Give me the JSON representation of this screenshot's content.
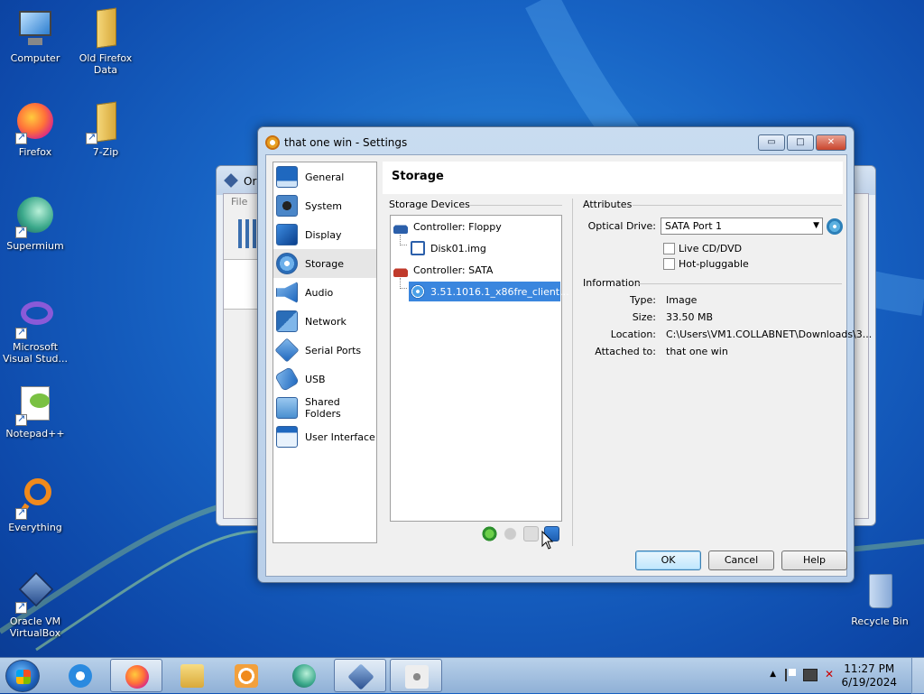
{
  "desktop": {
    "icons": [
      {
        "label": "Computer"
      },
      {
        "label": "Old Firefox Data"
      },
      {
        "label": "Firefox"
      },
      {
        "label": "7-Zip"
      },
      {
        "label": "Supermium"
      },
      {
        "label": "Microsoft Visual Stud..."
      },
      {
        "label": "Notepad++"
      },
      {
        "label": "Everything"
      },
      {
        "label": "Oracle VM VirtualBox"
      },
      {
        "label": "Recycle Bin"
      }
    ]
  },
  "background_window": {
    "title": "Ora",
    "menu_file": "File"
  },
  "dialog": {
    "title": "that one win - Settings",
    "min_glyph": "▭",
    "max_glyph": "□",
    "close_glyph": "✕",
    "nav": [
      {
        "label": "General"
      },
      {
        "label": "System"
      },
      {
        "label": "Display"
      },
      {
        "label": "Storage"
      },
      {
        "label": "Audio"
      },
      {
        "label": "Network"
      },
      {
        "label": "Serial Ports"
      },
      {
        "label": "USB"
      },
      {
        "label": "Shared Folders"
      },
      {
        "label": "User Interface"
      }
    ],
    "section_title": "Storage",
    "storage_devices_label": "Storage Devices",
    "tree": {
      "floppy_controller": "Controller: Floppy",
      "floppy_disk": "Disk01.img",
      "sata_controller": "Controller: SATA",
      "sata_optical": "3.51.1016.1_x86fre_client..."
    },
    "attributes_label": "Attributes",
    "optical_drive_label": "Optical Drive:",
    "optical_drive_value": "SATA Port 1",
    "live_cd_label": "Live CD/DVD",
    "hot_pluggable_label": "Hot-pluggable",
    "information_label": "Information",
    "info": {
      "type_label": "Type:",
      "type_value": "Image",
      "size_label": "Size:",
      "size_value": "33.50 MB",
      "location_label": "Location:",
      "location_value": "C:\\Users\\VM1.COLLABNET\\Downloads\\3...",
      "attached_label": "Attached to:",
      "attached_value": "that one win"
    },
    "buttons": {
      "ok": "OK",
      "cancel": "Cancel",
      "help": "Help"
    }
  },
  "taskbar": {
    "time": "11:27 PM",
    "date": "6/19/2024",
    "tray_arrow": "▲"
  }
}
